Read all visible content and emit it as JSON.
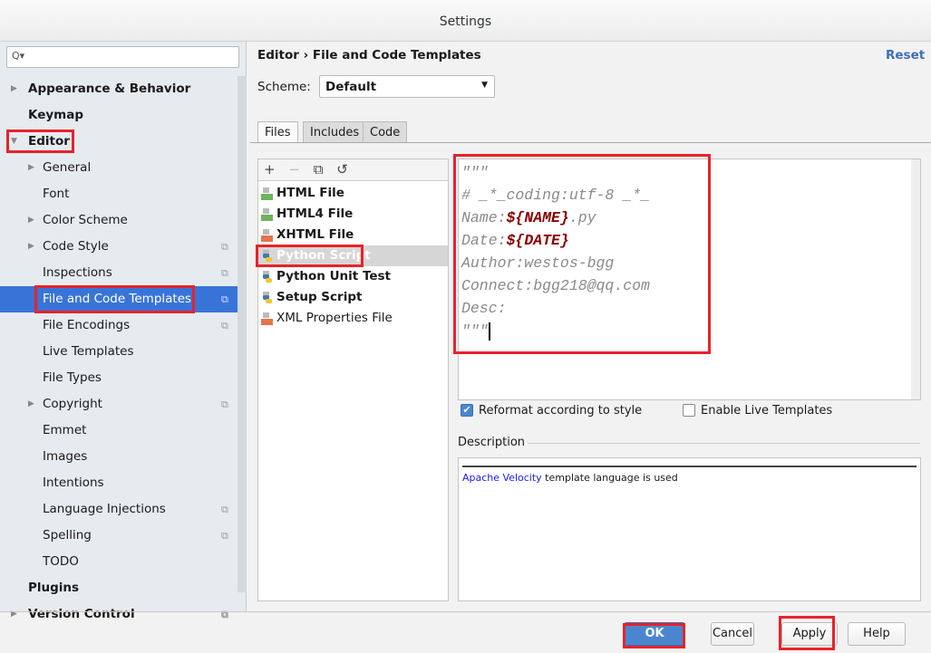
{
  "window": {
    "title": "Settings"
  },
  "sidebar": {
    "search_placeholder": "Q▾",
    "items": [
      {
        "label": "Appearance & Behavior",
        "level": 0,
        "arrow": "▶"
      },
      {
        "label": "Keymap",
        "level": 0
      },
      {
        "label": "Editor",
        "level": 0,
        "arrow": "▼"
      },
      {
        "label": "General",
        "level": 1,
        "arrow": "▶"
      },
      {
        "label": "Font",
        "level": 1
      },
      {
        "label": "Color Scheme",
        "level": 1,
        "arrow": "▶"
      },
      {
        "label": "Code Style",
        "level": 1,
        "arrow": "▶",
        "copy": true
      },
      {
        "label": "Inspections",
        "level": 1,
        "copy": true
      },
      {
        "label": "File and Code Templates",
        "level": 1,
        "copy": true,
        "selected": true
      },
      {
        "label": "File Encodings",
        "level": 1,
        "copy": true
      },
      {
        "label": "Live Templates",
        "level": 1
      },
      {
        "label": "File Types",
        "level": 1
      },
      {
        "label": "Copyright",
        "level": 1,
        "arrow": "▶",
        "copy": true
      },
      {
        "label": "Emmet",
        "level": 1
      },
      {
        "label": "Images",
        "level": 1
      },
      {
        "label": "Intentions",
        "level": 1
      },
      {
        "label": "Language Injections",
        "level": 1,
        "copy": true
      },
      {
        "label": "Spelling",
        "level": 1,
        "copy": true
      },
      {
        "label": "TODO",
        "level": 1
      },
      {
        "label": "Plugins",
        "level": 0
      },
      {
        "label": "Version Control",
        "level": 0,
        "arrow": "▶",
        "copy": true
      }
    ]
  },
  "header": {
    "breadcrumb_parent": "Editor",
    "breadcrumb_sep": "›",
    "breadcrumb_current": "File and Code Templates",
    "reset": "Reset"
  },
  "scheme": {
    "label": "Scheme:",
    "value": "Default"
  },
  "tabs": [
    {
      "label": "Files",
      "active": true
    },
    {
      "label": "Includes"
    },
    {
      "label": "Code"
    }
  ],
  "list_toolbar": {
    "add": "+",
    "remove": "−",
    "copy": "⧉",
    "reset": "↺"
  },
  "templates": [
    {
      "label": "HTML File",
      "icon": "html-file-icon",
      "color": "#6fb35f"
    },
    {
      "label": "HTML4 File",
      "icon": "html-file-icon",
      "color": "#6fb35f"
    },
    {
      "label": "XHTML File",
      "icon": "xhtml-file-icon",
      "color": "#e8734a"
    },
    {
      "label": "Python Script",
      "icon": "python-file-icon",
      "selected": true
    },
    {
      "label": "Python Unit Test",
      "icon": "python-file-icon"
    },
    {
      "label": "Setup Script",
      "icon": "python-file-icon"
    },
    {
      "label": "XML Properties File",
      "icon": "xml-file-icon",
      "color": "#e8734a",
      "plain": true
    }
  ],
  "editor": {
    "l1": "\"\"\"",
    "l2": "# _*_coding:utf-8 _*_",
    "l3a": "Name:",
    "l3b": "${NAME}",
    "l3c": ".py",
    "l4a": "Date:",
    "l4b": "${DATE}",
    "l5": "Author:westos-bgg",
    "l6": "Connect:bgg218@qq.com",
    "l7": "Desc:",
    "l8": "\"\"\""
  },
  "options": {
    "reformat": "Reformat according to style",
    "reformat_checked": true,
    "live": "Enable Live Templates",
    "live_checked": false
  },
  "description": {
    "label": "Description",
    "link": "Apache Velocity",
    "text": " template language is used"
  },
  "buttons": {
    "ok": "OK",
    "cancel": "Cancel",
    "apply": "Apply",
    "help": "Help"
  },
  "colors": {
    "accent": "#3874d8",
    "annotation": "#e8222a",
    "template_var": "#8b0000"
  }
}
